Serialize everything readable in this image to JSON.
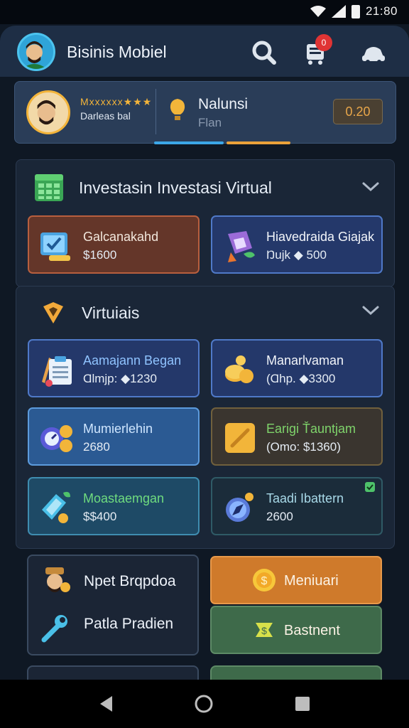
{
  "status_bar": {
    "time": "21:80"
  },
  "header": {
    "title": "Bisinis Mobiel",
    "cart_badge": "0",
    "icons": [
      "avatar",
      "search-icon",
      "cart-icon",
      "car-icon"
    ]
  },
  "profile": {
    "rank_stars": "Mxxxxxx★★★",
    "rank_label": "Darleas bal",
    "balance_label": "Nalunsi",
    "balance_sub": "Flan",
    "balance_value": "0.20"
  },
  "section1": {
    "title": "Investasin Investasi Virtual",
    "items": [
      {
        "title": "Galcanakahd",
        "sub": "$1600",
        "icon": "check-card-icon",
        "title_color": "#f2e7dc"
      },
      {
        "title": "Hiavedraida Giajak",
        "sub": "Ŋujk ◆ 500",
        "icon": "gem-plant-icon",
        "title_color": "#f2f5fa"
      }
    ]
  },
  "section2": {
    "title": "Virtuiais",
    "items": [
      {
        "title": "Aamajann Began",
        "sub": "Ɑlmjp: ◆1230",
        "icon": "clipboard-icon",
        "title_color": "#8fc3ff"
      },
      {
        "title": "Manarlvaman",
        "sub": "(Ɑhp. ◆3300",
        "icon": "coins-icon",
        "title_color": "#f2f5fa"
      },
      {
        "title": "Mumierlehin",
        "sub": "2680",
        "icon": "gauge-coins-icon",
        "title_color": "#cfe6ff"
      },
      {
        "title": "Earigi Ťauntjam",
        "sub": "(Omo: $1360)",
        "icon": "gold-card-icon",
        "title_color": "#7fd46b"
      },
      {
        "title": "Moastaemgan",
        "sub": "$$400",
        "icon": "tablet-coins-icon",
        "title_color": "#6fdc7f"
      },
      {
        "title": "Taadi Ibattern",
        "sub": "2600",
        "icon": "compass-icon",
        "title_color": "#a8d9e8"
      }
    ]
  },
  "bottom": {
    "left_items": [
      {
        "label": "Npet Brqpdoa",
        "icon": "merchant-icon"
      },
      {
        "label": "Patla Pradien",
        "icon": "wrench-icon"
      }
    ],
    "btn_orange": {
      "label": "Meniuari",
      "icon": "coin-icon"
    },
    "btn_green": {
      "label": "Bastnent",
      "icon": "dollar-icon"
    }
  },
  "colors": {
    "accent_blue": "#3ca7e8",
    "accent_orange": "#eba23a",
    "badge_red": "#e03434"
  }
}
